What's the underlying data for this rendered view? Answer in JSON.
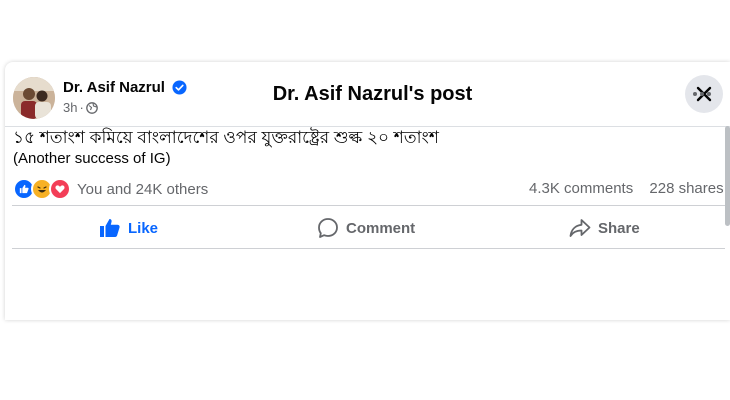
{
  "dialog": {
    "title": "Dr. Asif Nazrul's post"
  },
  "post": {
    "author": "Dr. Asif Nazrul",
    "time": "3h",
    "audience_icon": "globe-icon",
    "text": "১৫ শতাংশ কমিয়ে বাংলাদেশের ওপর যুক্তরাষ্ট্রের শুল্ক ২০ শতাংশ",
    "subtext": "(Another success of IG)",
    "reactions_label": "You and 24K others",
    "comments": "4.3K comments",
    "shares": "228 shares"
  },
  "actions": {
    "like": "Like",
    "comment": "Comment",
    "share": "Share"
  },
  "colors": {
    "accent": "#0866ff",
    "secondary_text": "#65676b",
    "love": "#f33e58",
    "haha": "#f7b125"
  }
}
